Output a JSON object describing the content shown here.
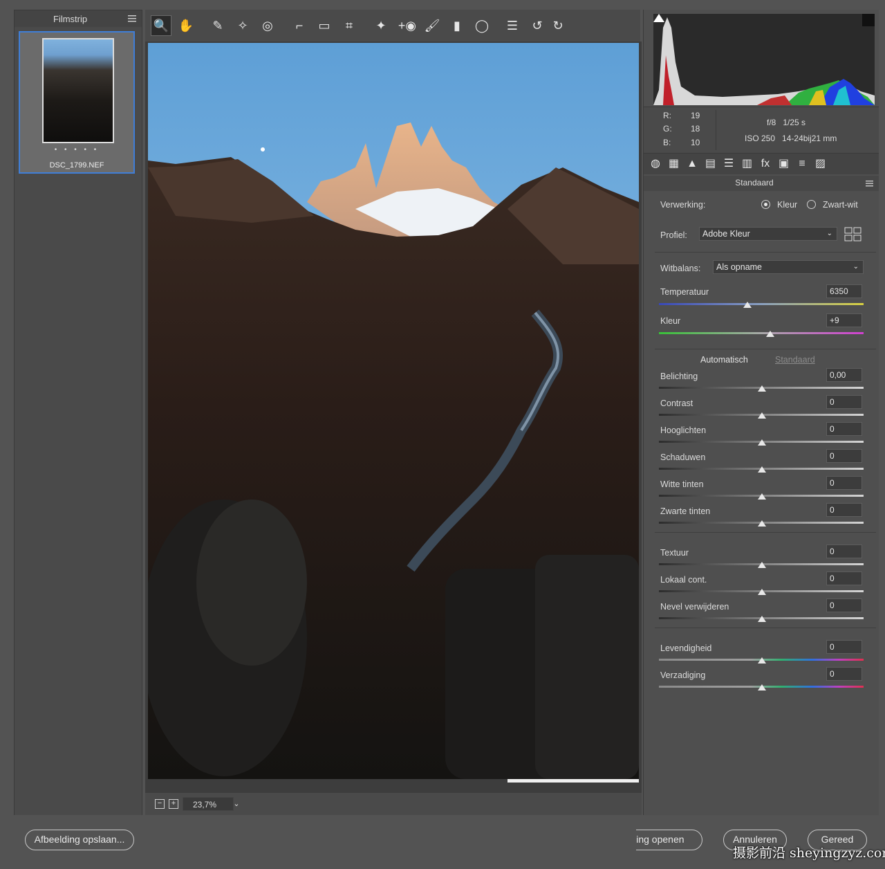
{
  "filmstrip": {
    "title": "Filmstrip",
    "item": {
      "rating_dots": "• • • • •",
      "filename": "DSC_1799.NEF"
    }
  },
  "toolbar": {
    "tools": [
      {
        "name": "zoom-tool",
        "glyph": "🔍",
        "active": true
      },
      {
        "name": "hand-tool",
        "glyph": "✋"
      },
      {
        "name": "white-balance-tool",
        "glyph": "✎"
      },
      {
        "name": "color-sampler-tool",
        "glyph": "✧"
      },
      {
        "name": "targeted-adjustment-tool",
        "glyph": "◎"
      },
      {
        "name": "crop-tool",
        "glyph": "⌐"
      },
      {
        "name": "straighten-tool",
        "glyph": "▭"
      },
      {
        "name": "transform-tool",
        "glyph": "⌗"
      },
      {
        "name": "spot-removal-tool",
        "glyph": "✦"
      },
      {
        "name": "red-eye-tool",
        "glyph": "+◉"
      },
      {
        "name": "adjustment-brush-tool",
        "glyph": "🖌"
      },
      {
        "name": "graduated-filter-tool",
        "glyph": "▮"
      },
      {
        "name": "radial-filter-tool",
        "glyph": "◯"
      },
      {
        "name": "preferences-tool",
        "glyph": "☰"
      },
      {
        "name": "rotate-left-tool",
        "glyph": "↺"
      },
      {
        "name": "rotate-right-tool",
        "glyph": "↻"
      }
    ]
  },
  "zoom": {
    "minus": "−",
    "plus": "+",
    "value": "23,7%",
    "dropdown": "⌄"
  },
  "readout": {
    "r_label": "R:",
    "r": "19",
    "g_label": "G:",
    "g": "18",
    "b_label": "B:",
    "b": "10",
    "aperture": "f/8",
    "shutter": "1/25 s",
    "iso": "ISO 250",
    "lens": "14-24bij21 mm"
  },
  "panel_tabs": [
    {
      "name": "basic-tab-icon",
      "glyph": "◍"
    },
    {
      "name": "tone-curve-tab-icon",
      "glyph": "▦"
    },
    {
      "name": "detail-tab-icon",
      "glyph": "▲"
    },
    {
      "name": "hsl-tab-icon",
      "glyph": "▤"
    },
    {
      "name": "split-toning-tab-icon",
      "glyph": "☰"
    },
    {
      "name": "lens-corrections-tab-icon",
      "glyph": "▥"
    },
    {
      "name": "effects-tab-icon",
      "glyph": "fx"
    },
    {
      "name": "calibration-tab-icon",
      "glyph": "▣"
    },
    {
      "name": "presets-tab-icon",
      "glyph": "≡"
    },
    {
      "name": "snapshots-tab-icon",
      "glyph": "▨"
    }
  ],
  "basic": {
    "section_title": "Standaard",
    "treatment_label": "Verwerking:",
    "treatment_color": "Kleur",
    "treatment_bw": "Zwart-wit",
    "profile_label": "Profiel:",
    "profile_value": "Adobe Kleur",
    "wb_label": "Witbalans:",
    "wb_value": "Als opname",
    "temperature_label": "Temperatuur",
    "temperature_value": "6350",
    "tint_label": "Kleur",
    "tint_value": "+9",
    "auto_label": "Automatisch",
    "default_label": "Standaard",
    "sliders": [
      {
        "key": "exposure",
        "label": "Belichting",
        "value": "0,00"
      },
      {
        "key": "contrast",
        "label": "Contrast",
        "value": "0"
      },
      {
        "key": "highlights",
        "label": "Hooglichten",
        "value": "0"
      },
      {
        "key": "shadows",
        "label": "Schaduwen",
        "value": "0"
      },
      {
        "key": "whites",
        "label": "Witte tinten",
        "value": "0"
      },
      {
        "key": "blacks",
        "label": "Zwarte tinten",
        "value": "0"
      },
      {
        "key": "texture",
        "label": "Textuur",
        "value": "0"
      },
      {
        "key": "clarity",
        "label": "Lokaal cont.",
        "value": "0"
      },
      {
        "key": "dehaze",
        "label": "Nevel verwijderen",
        "value": "0"
      },
      {
        "key": "vibrance",
        "label": "Levendigheid",
        "value": "0"
      },
      {
        "key": "saturation",
        "label": "Verzadiging",
        "value": "0"
      }
    ]
  },
  "bottom": {
    "save_label": "Afbeelding opslaan...",
    "open_label": "ding openen",
    "cancel_label": "Annuleren",
    "done_label": "Gereed"
  },
  "watermark": "摄影前沿 sheyingzyz.com"
}
